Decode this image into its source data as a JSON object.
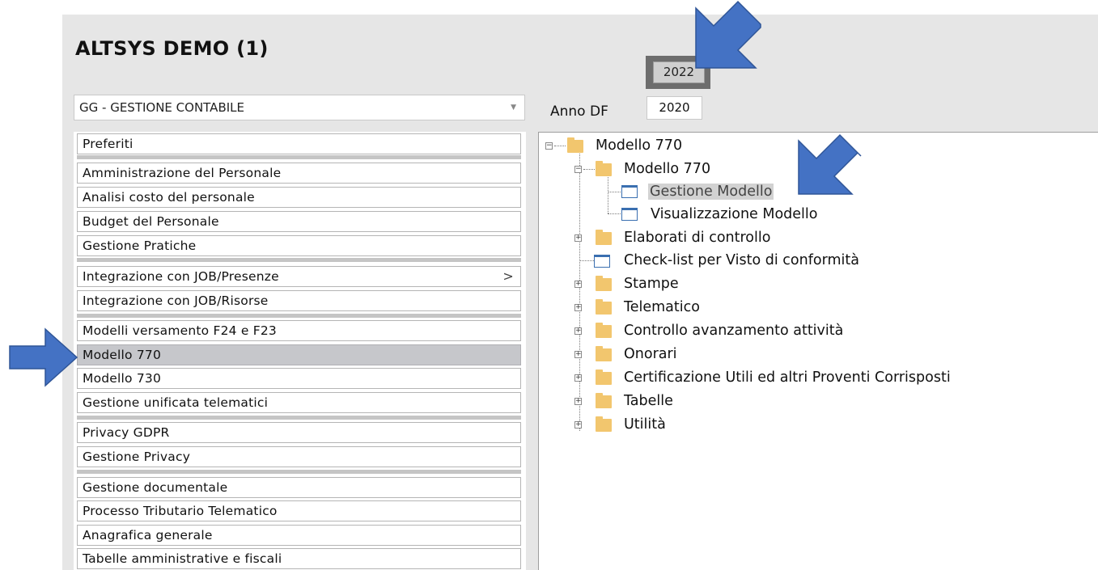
{
  "header": {
    "title": "ALTSYS DEMO (1)",
    "year_button": "2022"
  },
  "module_select": {
    "value": "GG - GESTIONE CONTABILE"
  },
  "anno": {
    "label": "Anno DF",
    "value": "2020"
  },
  "menu": {
    "items": [
      "Preferiti",
      "Amministrazione del Personale",
      "Analisi costo del personale",
      "Budget del Personale",
      "Gestione Pratiche",
      "Integrazione con JOB/Presenze",
      "Integrazione con JOB/Risorse",
      "Modelli versamento F24 e F23",
      "Modello 770",
      "Modello 730",
      "Gestione unificata telematici",
      "Privacy GDPR",
      "Gestione Privacy",
      "Gestione documentale",
      "Processo Tributario Telematico",
      "Anagrafica generale",
      "Tabelle amministrative e fiscali"
    ],
    "submenu_chevron": ">"
  },
  "tree": {
    "root": "Modello 770",
    "child": "Modello 770",
    "gestione": "Gestione Modello",
    "visualizzazione": "Visualizzazione Modello",
    "elaborati": "Elaborati di controllo",
    "checklist": "Check-list per Visto di conformità",
    "stampe": "Stampe",
    "telematico": "Telematico",
    "controllo": "Controllo avanzamento attività",
    "onorari": "Onorari",
    "certificazione": "Certificazione Utili ed altri Proventi Corrisposti",
    "tabelle": "Tabelle",
    "utilita": "Utilità"
  },
  "colors": {
    "arrow": "#4472c4",
    "folder": "#f2c66e",
    "selected_row": "#c6c7cb"
  }
}
